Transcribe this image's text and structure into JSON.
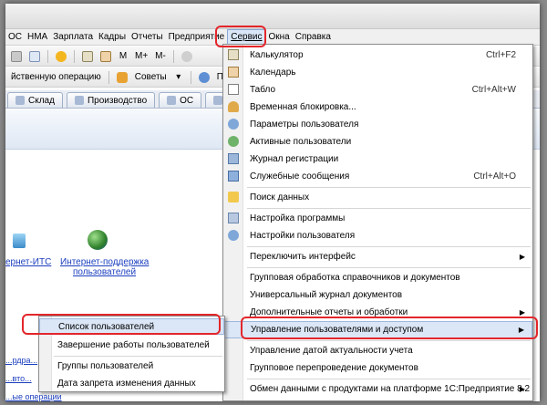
{
  "menubar": {
    "items": [
      "ОС",
      "НМА",
      "Зарплата",
      "Кадры",
      "Отчеты",
      "Предприятие",
      "Сервис",
      "Окна",
      "Справка"
    ]
  },
  "toolbar2": {
    "operation_label": "йственную операцию",
    "tips_label": "Советы",
    "guide_label": "Путеводи"
  },
  "toolbar1": {
    "calc_m": "М",
    "calc_mplus": "М+",
    "calc_mminus": "М-"
  },
  "tabs": [
    "Склад",
    "Производство",
    "ОС",
    "НМ"
  ],
  "workspace": {
    "its_link": "ернет-ИТС",
    "support_link_1": "Интернет-поддержка",
    "support_link_2": "пользователей",
    "frag_1": "...рдра...",
    "frag_2": "...вто...",
    "frag_3": "...ые операции"
  },
  "service_menu": {
    "items": [
      {
        "label": "Калькулятор",
        "shortcut": "Ctrl+F2",
        "icon": "calculator-icon"
      },
      {
        "label": "Календарь",
        "shortcut": "",
        "icon": "calendar-icon"
      },
      {
        "label": "Табло",
        "shortcut": "Ctrl+Alt+W",
        "icon": "scoreboard-icon"
      },
      {
        "label": "Временная блокировка...",
        "shortcut": "",
        "icon": "lock-icon"
      },
      {
        "label": "Параметры пользователя",
        "shortcut": "",
        "icon": "user-settings-icon"
      },
      {
        "label": "Активные пользователи",
        "shortcut": "",
        "icon": "active-users-icon"
      },
      {
        "label": "Журнал регистрации",
        "shortcut": "",
        "icon": "log-icon"
      },
      {
        "label": "Служебные сообщения",
        "shortcut": "Ctrl+Alt+O",
        "icon": "messages-icon"
      },
      {
        "label": "Поиск данных",
        "shortcut": "",
        "icon": "search-icon"
      },
      {
        "label": "Настройка программы",
        "shortcut": "",
        "icon": "program-settings-icon"
      },
      {
        "label": "Настройки пользователя",
        "shortcut": "",
        "icon": "user-prefs-icon"
      },
      {
        "label": "Переключить интерфейс",
        "shortcut": "",
        "icon": ""
      },
      {
        "label": "Групповая обработка справочников и документов",
        "shortcut": "",
        "icon": ""
      },
      {
        "label": "Универсальный журнал документов",
        "shortcut": "",
        "icon": ""
      },
      {
        "label": "Дополнительные отчеты и обработки",
        "shortcut": "",
        "icon": ""
      },
      {
        "label": "Управление пользователями и доступом",
        "shortcut": "",
        "icon": ""
      },
      {
        "label": "Управление датой актуальности учета",
        "shortcut": "",
        "icon": ""
      },
      {
        "label": "Групповое перепроведение документов",
        "shortcut": "",
        "icon": ""
      },
      {
        "label": "Обмен данными с продуктами на платформе 1С:Предприятие 8.2",
        "shortcut": "",
        "icon": ""
      }
    ]
  },
  "users_submenu": {
    "items": [
      "Список пользователей",
      "Завершение работы пользователей",
      "Группы пользователей",
      "Дата запрета изменения данных"
    ]
  }
}
